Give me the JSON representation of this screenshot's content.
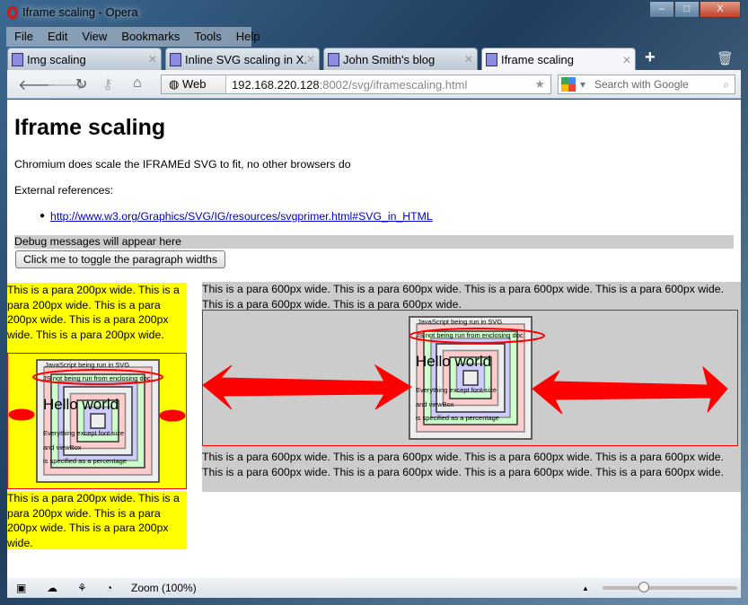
{
  "window": {
    "title": "Iframe scaling - Opera",
    "minimize": "–",
    "maximize": "□",
    "close": "X"
  },
  "menu": [
    "File",
    "Edit",
    "View",
    "Bookmarks",
    "Tools",
    "Help"
  ],
  "tabs": [
    {
      "label": "Img scaling"
    },
    {
      "label": "Inline SVG scaling in X..."
    },
    {
      "label": "John Smith's blog"
    },
    {
      "label": "Iframe scaling",
      "active": true
    }
  ],
  "toolbar": {
    "web_label": "Web",
    "url_host": "192.168.220.128",
    "url_rest": ":8002/svg/iframescaling.html",
    "search_placeholder": "Search with Google"
  },
  "page": {
    "heading": "Iframe scaling",
    "intro": "Chromium does scale the IFRAMEd SVG to fit, no other browsers do",
    "refs_label": "External references:",
    "link": "http://www.w3.org/Graphics/SVG/IG/resources/svgprimer.html#SVG_in_HTML",
    "debug": "Debug messages will appear here",
    "toggle_button": "Click me to toggle the paragraph widths",
    "para200": "This is a para 200px wide. This is a para 200px wide. This is a para 200px wide. This is a para 200px wide. This is a para 200px wide.",
    "para200b": "This is a para 200px wide. This is a para 200px wide. This is a para 200px wide. This is a para 200px wide.",
    "para600": "This is a para 600px wide. This is a para 600px wide. This is a para 600px wide. This is a para 600px wide. This is a para 600px wide. This is a para 600px wide.",
    "para600b": "This is a para 600px wide. This is a para 600px wide. This is a para 600px wide. This is a para 600px wide. This is a para 600px wide. This is a para 600px wide. This is a para 600px wide. This is a para 600px wide."
  },
  "svg": {
    "line1": "JavaScript being run in SVG",
    "line2": "JS not being run from enclosing doc",
    "hello": "Hello world",
    "note1": "Everything except font-size",
    "note2": "and viewBox",
    "note3": "is specified as a percentage"
  },
  "status": {
    "zoom": "Zoom (100%)",
    "zoom_level_percent": 100
  },
  "colors": {
    "highlight": "#ffff00",
    "annotation": "#ff0000",
    "gray_para": "#cccccc"
  }
}
